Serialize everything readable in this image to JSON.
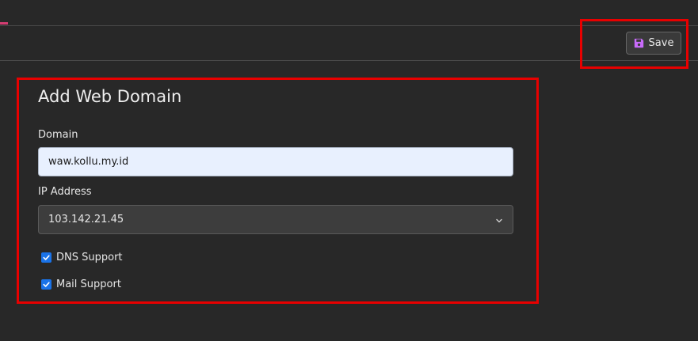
{
  "toolbar": {
    "save_label": "Save",
    "save_icon": "floppy-disk-icon"
  },
  "form": {
    "title": "Add Web Domain",
    "domain": {
      "label": "Domain",
      "value": "waw.kollu.my.id"
    },
    "ip_address": {
      "label": "IP Address",
      "selected": "103.142.21.45"
    },
    "options": [
      {
        "label": "DNS Support",
        "checked": true
      },
      {
        "label": "Mail Support",
        "checked": true
      }
    ]
  },
  "colors": {
    "background": "#282828",
    "accent": "#d33d72",
    "save_icon": "#c86bfa",
    "checkbox": "#1a73e8",
    "highlight": "#e80000"
  }
}
